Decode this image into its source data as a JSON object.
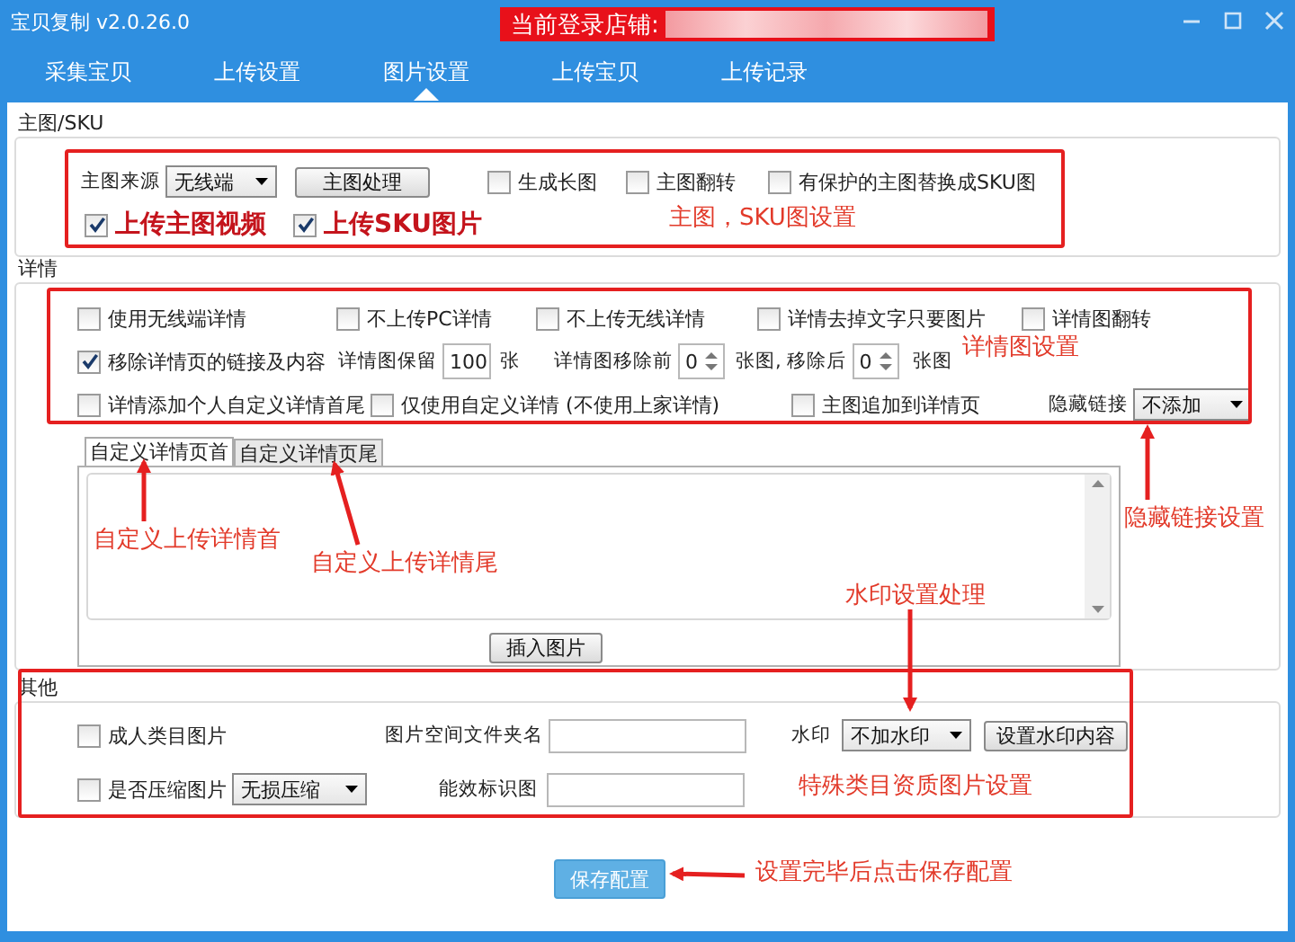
{
  "window": {
    "title": "宝贝复制 v2.0.26.0",
    "login_label": "当前登录店铺:"
  },
  "tabs": [
    {
      "label": "采集宝贝",
      "selected": false
    },
    {
      "label": "上传设置",
      "selected": false
    },
    {
      "label": "图片设置",
      "selected": true
    },
    {
      "label": "上传宝贝",
      "selected": false
    },
    {
      "label": "上传记录",
      "selected": false
    }
  ],
  "main_sku": {
    "legend": "主图/SKU",
    "source_label": "主图来源",
    "source_value": "无线端",
    "process_button": "主图处理",
    "options": [
      {
        "label": "生成长图",
        "checked": false
      },
      {
        "label": "主图翻转",
        "checked": false
      },
      {
        "label": "有保护的主图替换成SKU图",
        "checked": false
      }
    ],
    "uploads": [
      {
        "label": "上传主图视频",
        "checked": true
      },
      {
        "label": "上传SKU图片",
        "checked": true
      }
    ]
  },
  "detail": {
    "legend": "详情",
    "row1": [
      {
        "label": "使用无线端详情",
        "checked": false
      },
      {
        "label": "不上传PC详情",
        "checked": false
      },
      {
        "label": "不上传无线详情",
        "checked": false
      },
      {
        "label": "详情去掉文字只要图片",
        "checked": false
      },
      {
        "label": "详情图翻转",
        "checked": false
      }
    ],
    "remove_links": {
      "label": "移除详情页的链接及内容",
      "checked": true
    },
    "keep_label": "详情图保留",
    "keep_value": "100",
    "keep_unit": "张",
    "remove_before_label": "详情图移除前",
    "remove_before_value": "0",
    "remove_after_label": "张图, 移除后",
    "remove_after_value": "0",
    "remove_after_unit": "张图",
    "row3": [
      {
        "label": "详情添加个人自定义详情首尾",
        "checked": false
      },
      {
        "label": "仅使用自定义详情 (不使用上家详情)",
        "checked": false
      },
      {
        "label": "主图追加到详情页",
        "checked": false
      }
    ],
    "hide_link_label": "隐藏链接",
    "hide_link_value": "不添加",
    "editor_tabs": [
      {
        "label": "自定义详情页首",
        "selected": true
      },
      {
        "label": "自定义详情页尾",
        "selected": false
      }
    ],
    "insert_button": "插入图片"
  },
  "other": {
    "legend": "其他",
    "adult": {
      "label": "成人类目图片",
      "checked": false
    },
    "folder_label": "图片空间文件夹名",
    "watermark_label": "水印",
    "watermark_value": "不加水印",
    "watermark_button": "设置水印内容",
    "compress": {
      "label": "是否压缩图片",
      "checked": false
    },
    "compress_value": "无损压缩",
    "energy_label": "能效标识图"
  },
  "save_button": "保存配置",
  "annotations": [
    {
      "text": "主图，SKU图设置"
    },
    {
      "text": "详情图设置"
    },
    {
      "text": "隐藏链接设置"
    },
    {
      "text": "自定义上传详情首"
    },
    {
      "text": "自定义上传详情尾"
    },
    {
      "text": "水印设置处理"
    },
    {
      "text": "特殊类目资质图片设置"
    },
    {
      "text": "设置完毕后点击保存配置"
    }
  ]
}
